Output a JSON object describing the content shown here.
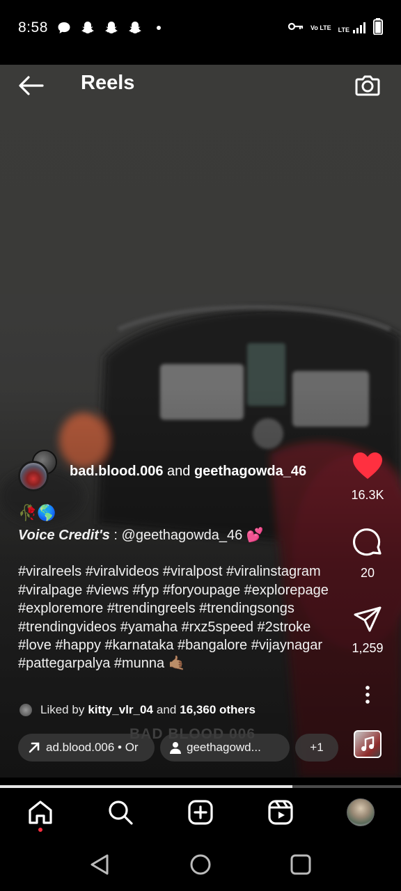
{
  "status_bar": {
    "time": "8:58",
    "left_icons": [
      "chat-icon",
      "snapchat-icon",
      "snapchat-icon",
      "snapchat-icon",
      "dot-icon"
    ],
    "right_icons": [
      "key-icon",
      "volte-icon",
      "lte-signal-icon",
      "battery-icon"
    ],
    "volte_text": "Vo LTE",
    "lte_text": "LTE"
  },
  "header": {
    "title": "Reels"
  },
  "actions": {
    "likes": "16.3K",
    "comments": "20",
    "shares": "1,259",
    "like_color": "#ff3040"
  },
  "post": {
    "author1": "bad.blood.006",
    "connector": "and",
    "author2": "geethagowda_46",
    "emoji_line": "🥀🌎",
    "credit_label": "Voice Credit's",
    "credit_sep": " : ",
    "credit_mention": "@geethagowda_46",
    "credit_emoji": " 💕",
    "hashtags": "#viralreels #viralvideos #viralpost #viralinstagram #viralpage #views #fyp #foryoupage #explorepage #exploremore #trendingreels #trendingsongs #trendingvideos #yamaha #rxz5speed #2stroke #love #happy #karnataka #bangalore #vijaynagar #pattegarpalya #munna 🤙🏽",
    "liked_prefix": "Liked by",
    "liked_user": "kitty_vlr_04",
    "liked_and": "and",
    "liked_others": "16,360 others",
    "watermark": "BAD BLOOD 006"
  },
  "chips": {
    "link_text": "ad.blood.006 • Or",
    "user_text": "geethagowd...",
    "more_text": "+1"
  },
  "progress": {
    "fraction": 0.73
  },
  "bottom_nav": {
    "items": [
      "home-icon",
      "search-icon",
      "create-icon",
      "reels-icon",
      "profile-avatar"
    ],
    "active": "home-icon"
  },
  "android_nav": [
    "back-icon",
    "home-circle-icon",
    "recents-icon"
  ]
}
